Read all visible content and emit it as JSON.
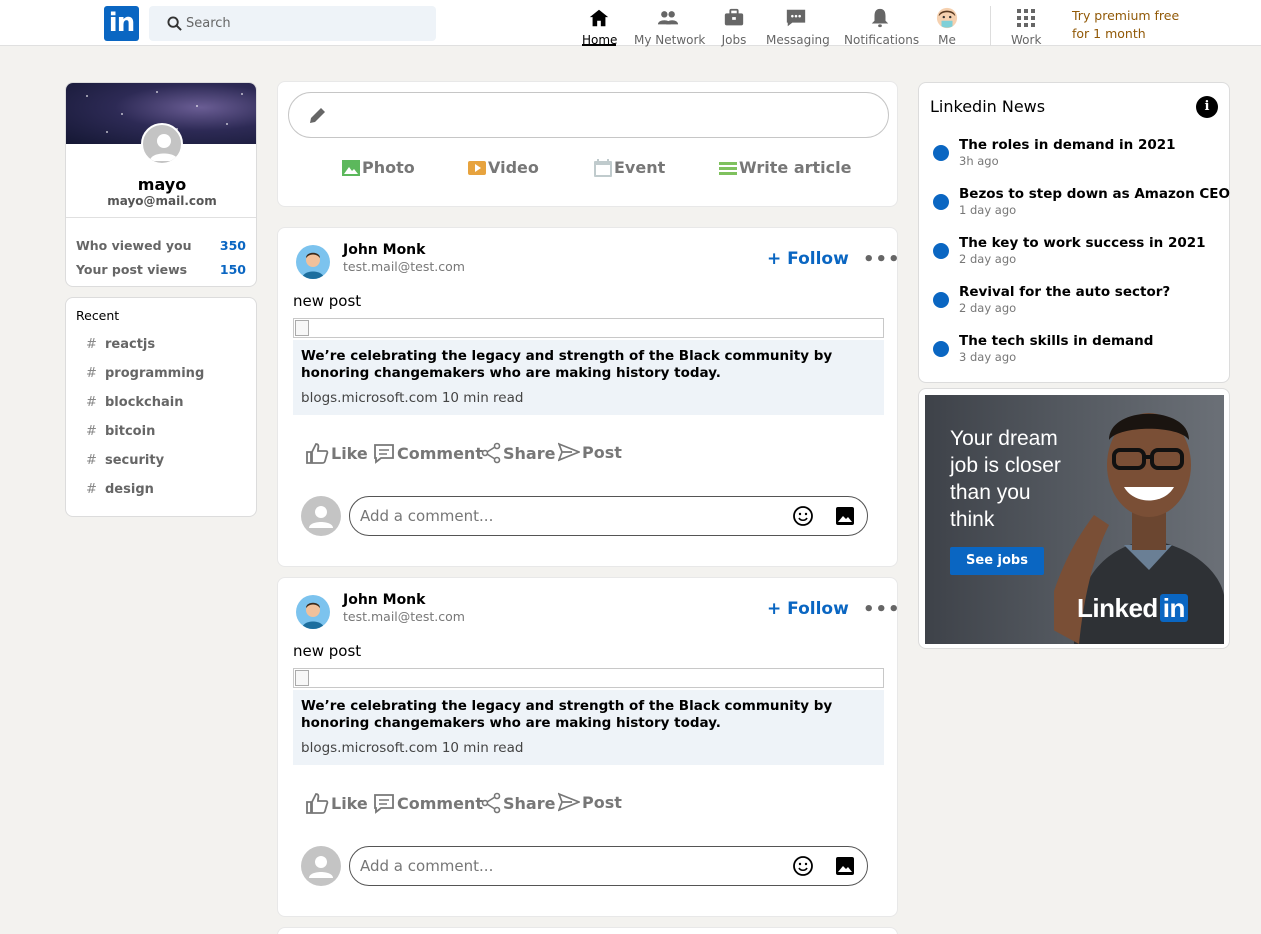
{
  "header": {
    "logo_text": "in",
    "search_placeholder": "Search",
    "nav": [
      {
        "label": "Home",
        "icon": "home-icon"
      },
      {
        "label": "My Network",
        "icon": "network-icon"
      },
      {
        "label": "Jobs",
        "icon": "briefcase-icon"
      },
      {
        "label": "Messaging",
        "icon": "message-icon"
      },
      {
        "label": "Notifications",
        "icon": "bell-icon"
      },
      {
        "label": "Me",
        "icon": "avatar"
      },
      {
        "label": "Work",
        "icon": "grid-icon"
      }
    ],
    "premium_line1": "Try premium free",
    "premium_line2": "for 1 month"
  },
  "profile": {
    "name": "mayo",
    "email": "mayo@mail.com",
    "stats": [
      {
        "label": "Who viewed you",
        "value": "350"
      },
      {
        "label": "Your post views",
        "value": "150"
      }
    ]
  },
  "recent": {
    "title": "Recent",
    "tags": [
      "reactjs",
      "programming",
      "blockchain",
      "bitcoin",
      "security",
      "design"
    ]
  },
  "share_box": {
    "actions": [
      {
        "label": "Photo",
        "color": "#70b5f9"
      },
      {
        "label": "Video",
        "color": "#e7a33e"
      },
      {
        "label": "Event",
        "color": "#c0cbcd"
      },
      {
        "label": "Write article",
        "color": "#7fc15e"
      }
    ]
  },
  "posts": [
    {
      "author": "John Monk",
      "email": "test.mail@test.com",
      "follow_label": "+ Follow",
      "text": "new post",
      "article_title": "We’re celebrating the legacy and strength of the Black community by honoring changemakers who are making history today.",
      "article_source": "blogs.microsoft.com 10 min read",
      "actions": [
        "Like",
        "Comment",
        "Share",
        "Post"
      ],
      "comment_placeholder": "Add a comment..."
    },
    {
      "author": "John Monk",
      "email": "test.mail@test.com",
      "follow_label": "+ Follow",
      "text": "new post",
      "article_title": "We’re celebrating the legacy and strength of the Black community by honoring changemakers who are making history today.",
      "article_source": "blogs.microsoft.com 10 min read",
      "actions": [
        "Like",
        "Comment",
        "Share",
        "Post"
      ],
      "comment_placeholder": "Add a comment..."
    }
  ],
  "news": {
    "title": "Linkedin News",
    "items": [
      {
        "headline": "The roles in demand in 2021",
        "time": "3h ago"
      },
      {
        "headline": "Bezos to step down as Amazon CEO",
        "time": "1 day ago"
      },
      {
        "headline": "The key to work success in 2021",
        "time": "2 day ago"
      },
      {
        "headline": "Revival for the auto sector?",
        "time": "2 day ago"
      },
      {
        "headline": "The tech skills in demand",
        "time": "3 day ago"
      }
    ]
  },
  "ad": {
    "headline": "Your dream job is closer than you think",
    "cta": "See jobs",
    "brand_text": "Linked",
    "brand_in": "in"
  },
  "colors": {
    "accent": "#0a66c2",
    "premium": "#915907",
    "background": "#f3f2ef"
  }
}
